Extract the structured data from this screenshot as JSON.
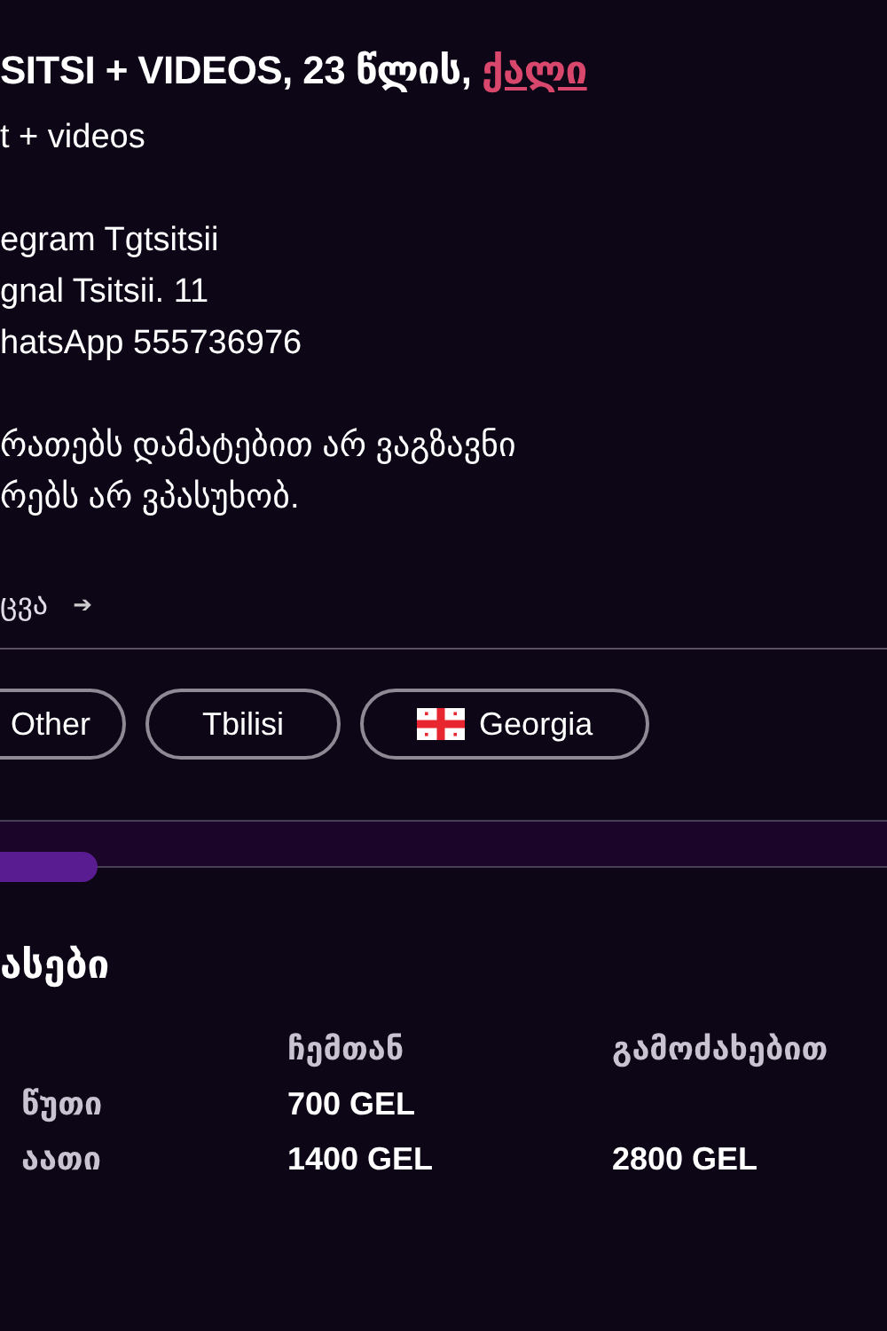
{
  "title": {
    "text": "SITSI + VIDEOS, 23 წლის, ",
    "link": "ქალი"
  },
  "description": [
    [
      "t + videos"
    ],
    [
      "egram Tgtsitsii",
      "gnal Tsitsii. 11",
      "hatsApp 555736976"
    ],
    [
      "რათებს დამატებით არ ვაგზავნი",
      "რებს არ ვპასუხობ."
    ]
  ],
  "more_link": {
    "label": "ცვა",
    "arrow": "➔"
  },
  "tags": [
    {
      "label": "Other",
      "kind": "plain"
    },
    {
      "label": "Tbilisi",
      "kind": "plain"
    },
    {
      "label": "Georgia",
      "kind": "flag"
    }
  ],
  "progress": {
    "level": 0.11
  },
  "rates": {
    "heading": "ასები",
    "columns": [
      "ჩემთან",
      "გამოძახებით"
    ],
    "rows": [
      {
        "label": "წუთი",
        "column_1": "700 GEL"
      },
      {
        "label": "აათი",
        "column_1": "1400 GEL",
        "column_2": "2800 GEL"
      }
    ]
  }
}
